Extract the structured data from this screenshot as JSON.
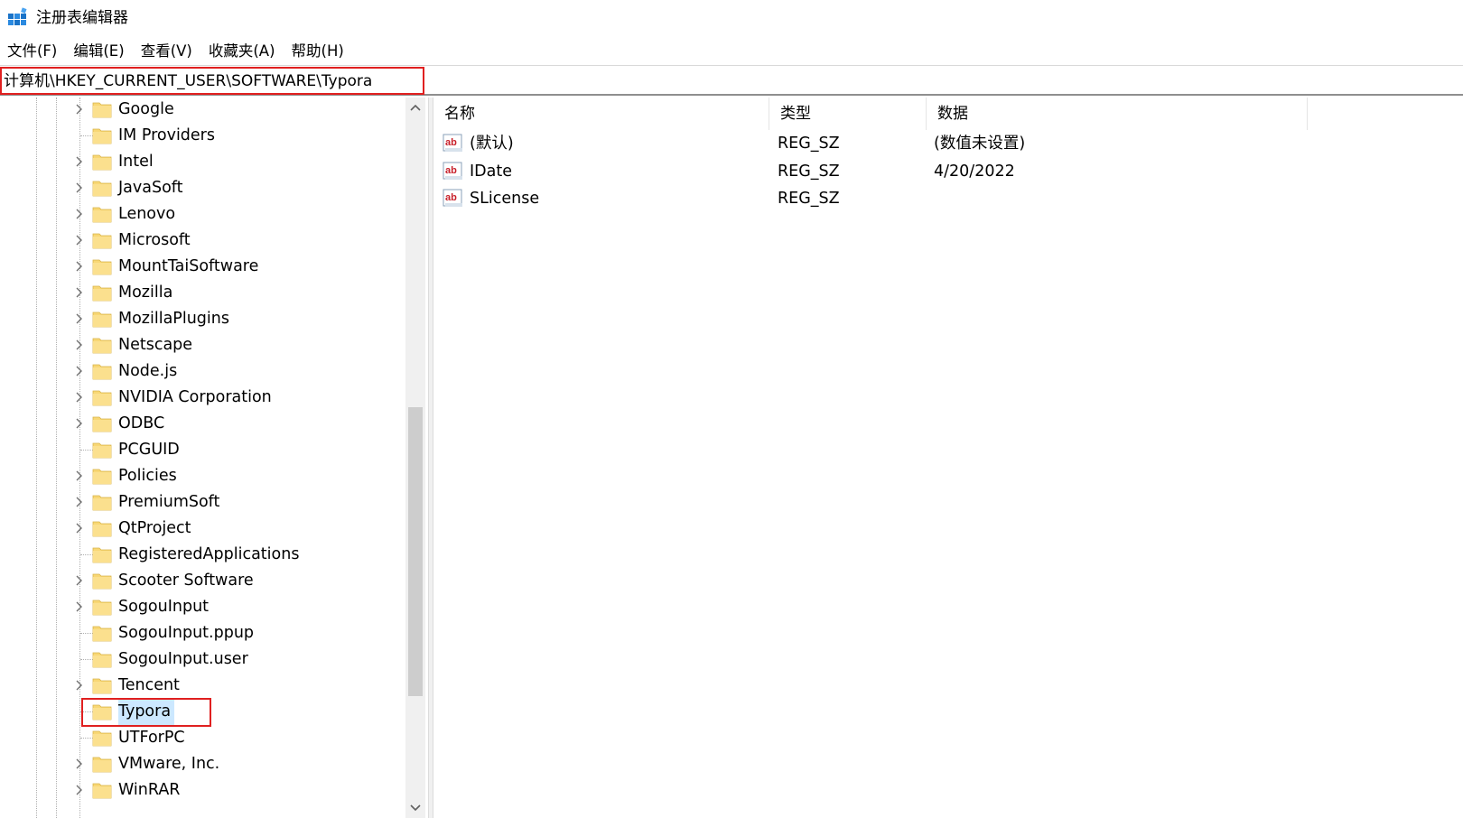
{
  "window": {
    "title": "注册表编辑器"
  },
  "menu": [
    "文件(F)",
    "编辑(E)",
    "查看(V)",
    "收藏夹(A)",
    "帮助(H)"
  ],
  "address": {
    "path": "计算机\\HKEY_CURRENT_USER\\SOFTWARE\\Typora"
  },
  "tree": {
    "nodes": [
      {
        "label": "Google",
        "expandable": true
      },
      {
        "label": "IM Providers",
        "expandable": false
      },
      {
        "label": "Intel",
        "expandable": true
      },
      {
        "label": "JavaSoft",
        "expandable": true
      },
      {
        "label": "Lenovo",
        "expandable": true
      },
      {
        "label": "Microsoft",
        "expandable": true
      },
      {
        "label": "MountTaiSoftware",
        "expandable": true
      },
      {
        "label": "Mozilla",
        "expandable": true
      },
      {
        "label": "MozillaPlugins",
        "expandable": true
      },
      {
        "label": "Netscape",
        "expandable": true
      },
      {
        "label": "Node.js",
        "expandable": true
      },
      {
        "label": "NVIDIA Corporation",
        "expandable": true
      },
      {
        "label": "ODBC",
        "expandable": true
      },
      {
        "label": "PCGUID",
        "expandable": false
      },
      {
        "label": "Policies",
        "expandable": true
      },
      {
        "label": "PremiumSoft",
        "expandable": true
      },
      {
        "label": "QtProject",
        "expandable": true
      },
      {
        "label": "RegisteredApplications",
        "expandable": false
      },
      {
        "label": "Scooter Software",
        "expandable": true
      },
      {
        "label": "SogouInput",
        "expandable": true
      },
      {
        "label": "SogouInput.ppup",
        "expandable": false
      },
      {
        "label": "SogouInput.user",
        "expandable": false
      },
      {
        "label": "Tencent",
        "expandable": true
      },
      {
        "label": "Typora",
        "expandable": false,
        "selected": true
      },
      {
        "label": "UTForPC",
        "expandable": false
      },
      {
        "label": "VMware, Inc.",
        "expandable": true
      },
      {
        "label": "WinRAR",
        "expandable": true
      }
    ]
  },
  "list": {
    "columns": [
      "名称",
      "类型",
      "数据"
    ],
    "rows": [
      {
        "name": "(默认)",
        "type": "REG_SZ",
        "data": "(数值未设置)"
      },
      {
        "name": "IDate",
        "type": "REG_SZ",
        "data": "4/20/2022"
      },
      {
        "name": "SLicense",
        "type": "REG_SZ",
        "data": ""
      }
    ]
  },
  "colors": {
    "highlight_box": "#e02020",
    "selection": "#cce8ff",
    "folder": "#f8d775"
  }
}
